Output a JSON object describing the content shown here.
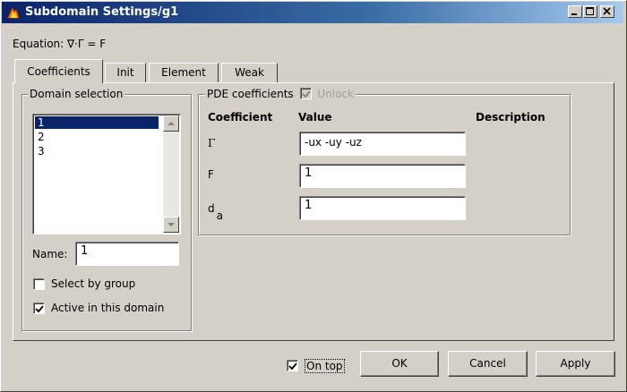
{
  "window": {
    "title": "Subdomain Settings/g1"
  },
  "equation": "Equation: ∇·Γ = F",
  "tabs": [
    {
      "label": "Coefficients",
      "active": true
    },
    {
      "label": "Init",
      "active": false
    },
    {
      "label": "Element",
      "active": false
    },
    {
      "label": "Weak",
      "active": false
    }
  ],
  "domain_selection": {
    "legend": "Domain selection",
    "items": [
      "1",
      "2",
      "3"
    ],
    "selected": "1",
    "name_label": "Name:",
    "name_value": "1",
    "select_by_group": {
      "label": "Select by group",
      "checked": false
    },
    "active_in_domain": {
      "label": "Active in this domain",
      "checked": true
    }
  },
  "pde": {
    "legend": "PDE coefficients",
    "unlock": {
      "label": "Unlock",
      "checked": true,
      "disabled": true
    },
    "headers": {
      "coefficient": "Coefficient",
      "value": "Value",
      "description": "Description"
    },
    "rows": [
      {
        "symbol": "Γ",
        "value": "-ux -uy -uz"
      },
      {
        "symbol": "F",
        "value": "1"
      },
      {
        "symbol_base": "d",
        "symbol_sub": "a",
        "value": "1"
      }
    ]
  },
  "footer": {
    "on_top": {
      "label": "On top",
      "checked": true
    },
    "ok": "OK",
    "cancel": "Cancel",
    "apply": "Apply"
  },
  "colors": {
    "titlebar_start": "#0a246a",
    "titlebar_end": "#a6caf0",
    "face": "#d4d0c8",
    "selection": "#0a246a"
  }
}
